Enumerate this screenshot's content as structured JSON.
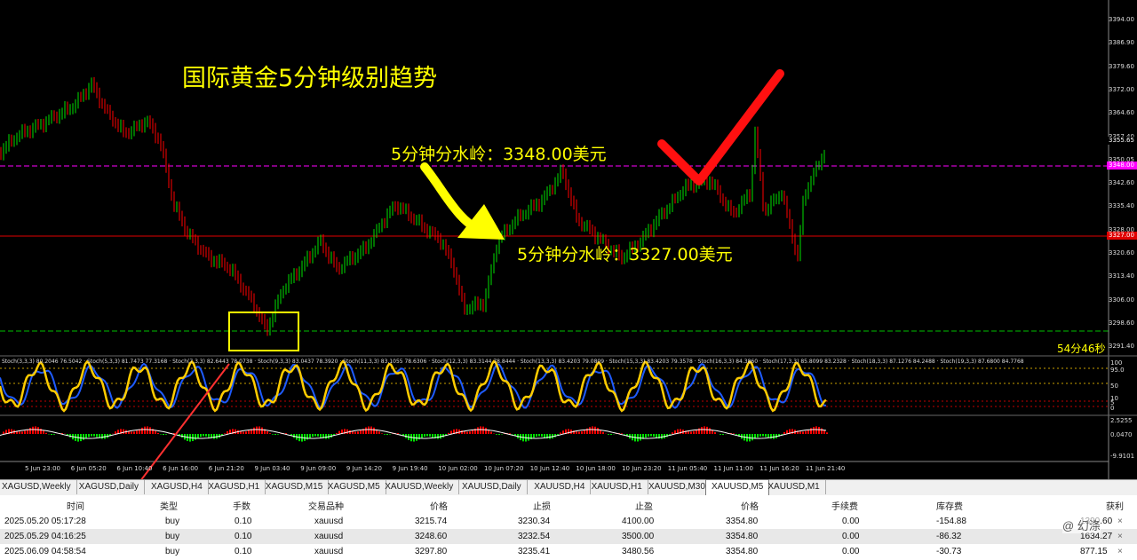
{
  "annotations": {
    "title": "国际黄金5分钟级别趋势",
    "upper_level": "5分钟分水岭：3348.00美元",
    "lower_level": "5分钟分水岭：3327.00美元",
    "countdown": "54分46秒"
  },
  "price_axis": [
    "3394.00",
    "3386.90",
    "3379.60",
    "3372.00",
    "3364.60",
    "3357.40",
    "3350.05",
    "3342.60",
    "3335.40",
    "3328.00",
    "3320.60",
    "3313.40",
    "3306.00",
    "3298.60",
    "3291.40"
  ],
  "price_tags": {
    "current": "3355.65",
    "magenta": "3348.00",
    "red": "3327.00"
  },
  "stoch_text": "Stoch(3,3,3) 80.2046 76.5042 · Stoch(5,3,3) 81.7473 77.3168 · Stoch(7,3,3) 82.6443 78.0738 · Stoch(9,3,3) 83.0437 78.3920 · Stoch(11,3,3) 83.1055 78.6306 · Stoch(12,3,3) 83.3144 78.8444 · Stoch(13,3,3) 83.4203 79.0809 · Stoch(15,3,3) 83.4203 79.3578 · Stoch(16,3,3) 84.3860 · Stoch(17,3,3) 85.8099 83.2328 · Stoch(18,3,3) 87.1276 84.2488 · Stoch(19,3,3) 87.6800 84.7768",
  "stoch_axis": [
    "100",
    "95.0",
    "50",
    "10",
    "5",
    "0"
  ],
  "macd_axis": [
    "2.5255",
    "0.0470",
    "-9.9101"
  ],
  "time_axis": [
    "5 Jun 23:00",
    "6 Jun 05:20",
    "6 Jun 10:40",
    "6 Jun 16:00",
    "6 Jun 21:20",
    "9 Jun 03:40",
    "9 Jun 09:00",
    "9 Jun 14:20",
    "9 Jun 19:40",
    "10 Jun 02:00",
    "10 Jun 07:20",
    "10 Jun 12:40",
    "10 Jun 18:00",
    "10 Jun 23:20",
    "11 Jun 05:40",
    "11 Jun 11:00",
    "11 Jun 16:20",
    "11 Jun 21:40"
  ],
  "tabs": [
    "XAGUSD,Weekly",
    "XAGUSD,Daily",
    "XAGUSD,H4",
    "XAGUSD,H1",
    "XAGUSD,M15",
    "XAGUSD,M5",
    "XAUUSD,Weekly",
    "XAUUSD,Daily",
    "XAUUSD,H4",
    "XAUUSD,H1",
    "XAUUSD,M30",
    "XAUUSD,M5",
    "XAUUSD,M1"
  ],
  "active_tab": "XAUUSD,M5",
  "table": {
    "headers": {
      "time": "时间",
      "type": "类型",
      "lots": "手数",
      "symbol": "交易品种",
      "price": "价格",
      "sl": "止损",
      "tp": "止盈",
      "price2": "价格",
      "commission": "手续费",
      "swap": "库存费",
      "profit": "获利"
    },
    "rows": [
      {
        "time": "2025.05.20 05:17:28",
        "type": "buy",
        "lots": "0.10",
        "symbol": "xauusd",
        "price": "3215.74",
        "sl": "3230.34",
        "tp": "4100.00",
        "price2": "3354.80",
        "commission": "0.00",
        "swap": "-154.88",
        "profit": "1390.60"
      },
      {
        "time": "2025.05.29 04:16:25",
        "type": "buy",
        "lots": "0.10",
        "symbol": "xauusd",
        "price": "3248.60",
        "sl": "3232.54",
        "tp": "3500.00",
        "price2": "3354.80",
        "commission": "0.00",
        "swap": "-86.32",
        "profit": "1634.27"
      },
      {
        "time": "2025.06.09 04:58:54",
        "type": "buy",
        "lots": "0.10",
        "symbol": "xauusd",
        "price": "3297.80",
        "sl": "3235.41",
        "tp": "3480.56",
        "price2": "3354.80",
        "commission": "0.00",
        "swap": "-30.73",
        "profit": "877.15"
      }
    ]
  },
  "watermark": "@ 幻涤",
  "colors": {
    "bull": "#00e000",
    "bear": "#ff0000",
    "stoch_main": "#ffcc00",
    "stoch_sig": "#1e5bff",
    "magenta_line": "#ff00ff",
    "red_line": "#e00000",
    "annotation": "#ffff00"
  }
}
